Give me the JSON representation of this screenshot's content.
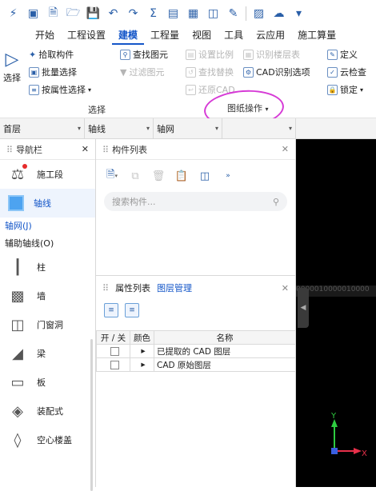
{
  "quick_access": {
    "icons": [
      "app-logo-icon",
      "window-icon",
      "new-file-icon",
      "open-folder-icon",
      "save-icon",
      "undo-icon",
      "redo-icon",
      "sum-icon",
      "view-icon",
      "grid-icon",
      "component-icon",
      "draw-icon",
      "split-icon",
      "cloud-icon",
      "more-icon"
    ]
  },
  "menu": {
    "tabs": [
      "开始",
      "工程设置",
      "建模",
      "工程量",
      "视图",
      "工具",
      "云应用",
      "施工算量"
    ],
    "active": "建模"
  },
  "ribbon": {
    "select_label": "选择",
    "pick_component": "拾取构件",
    "batch_select": "批量选择",
    "select_by_attr": "按属性选择",
    "find_element": "查找图元",
    "filter_element": "过滤图元",
    "set_scale": "设置比例",
    "find_replace": "查找替换",
    "restore_cad": "还原CAD",
    "identify_floor": "识别楼层表",
    "cad_identify": "CAD识别选项",
    "define": "定义",
    "cloud_check": "云检查",
    "lock": "锁定",
    "group_select": "选择",
    "group_drawing": "图纸操作"
  },
  "selectors": {
    "floor": "首层",
    "category": "轴线",
    "subtype": "轴网",
    "extra": ""
  },
  "nav": {
    "title": "导航栏",
    "items": [
      {
        "label": "施工段",
        "icon": "construction-section-icon"
      },
      {
        "label": "轴线",
        "icon": "axis-grid-icon"
      },
      {
        "label": "柱",
        "icon": "column-icon"
      },
      {
        "label": "墙",
        "icon": "wall-icon"
      },
      {
        "label": "门窗洞",
        "icon": "door-window-icon"
      },
      {
        "label": "梁",
        "icon": "beam-icon"
      },
      {
        "label": "板",
        "icon": "slab-icon"
      },
      {
        "label": "装配式",
        "icon": "prefab-icon"
      },
      {
        "label": "空心楼盖",
        "icon": "hollow-floor-icon"
      }
    ],
    "subitems": [
      "轴网(J)",
      "辅助轴线(O)"
    ]
  },
  "component_list": {
    "title": "构件列表",
    "search_placeholder": "搜索构件..."
  },
  "properties": {
    "tab_properties": "属性列表",
    "tab_layers": "图层管理",
    "table_headers": [
      "开 / 关",
      "颜色",
      "名称"
    ],
    "rows": [
      {
        "name": "已提取的 CAD 图层"
      },
      {
        "name": "CAD 原始图层"
      }
    ]
  },
  "viewport": {
    "coord_strip": "0000010000010000",
    "axis_y": "Y",
    "axis_x": "X"
  }
}
